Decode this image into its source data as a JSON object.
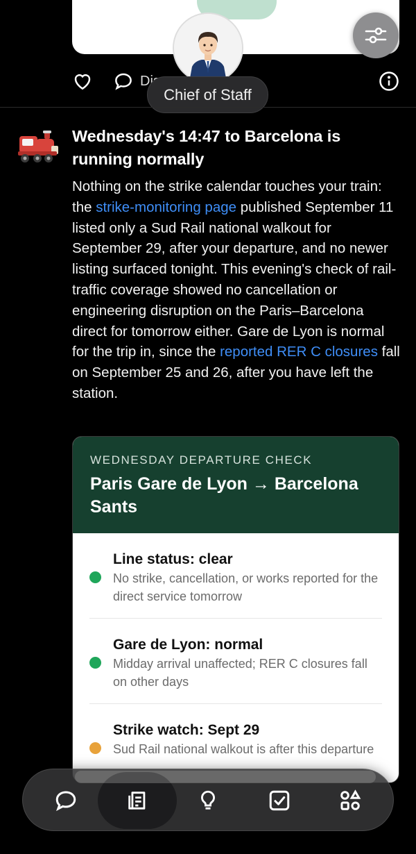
{
  "avatar": {
    "label": "Chief of Staff"
  },
  "actions": {
    "discuss_label": "Discuss"
  },
  "message": {
    "title": "Wednesday's 14:47 to Barcelona is running normally",
    "body_parts": [
      "Nothing on the strike calendar touches your train: the ",
      "strike-monitoring page",
      " published September 11 listed only a Sud Rail national walkout for September 29, after your departure, and no newer listing surfaced tonight. This evening's check of rail-traffic coverage showed no cancellation or engineering disruption on the Paris–Barcelona direct for tomorrow either. Gare de Lyon is normal for the trip in, since the ",
      "reported RER C closures",
      " fall on September 25 and 26, after you have left the station."
    ]
  },
  "card": {
    "eyebrow": "WEDNESDAY DEPARTURE CHECK",
    "route": "Paris Gare de Lyon → Barcelona Sants",
    "items": [
      {
        "title": "Line status: clear",
        "desc": "No strike, cancellation, or works reported for the direct service tomorrow",
        "color": "#1fa65a"
      },
      {
        "title": "Gare de Lyon: normal",
        "desc": "Midday arrival unaffected; RER C closures fall on other days",
        "color": "#1fa65a"
      },
      {
        "title": "Strike watch: Sept 29",
        "desc": "Sud Rail national walkout is after this departure",
        "color": "#e8a23a"
      }
    ]
  },
  "nav": {
    "items": [
      {
        "name": "chat-icon"
      },
      {
        "name": "notes-icon"
      },
      {
        "name": "lightbulb-icon"
      },
      {
        "name": "checkbox-icon"
      },
      {
        "name": "apps-icon"
      }
    ]
  },
  "colors": {
    "link": "#3f8ef7",
    "card_header": "#16402f",
    "ok": "#1fa65a",
    "warn": "#e8a23a"
  }
}
